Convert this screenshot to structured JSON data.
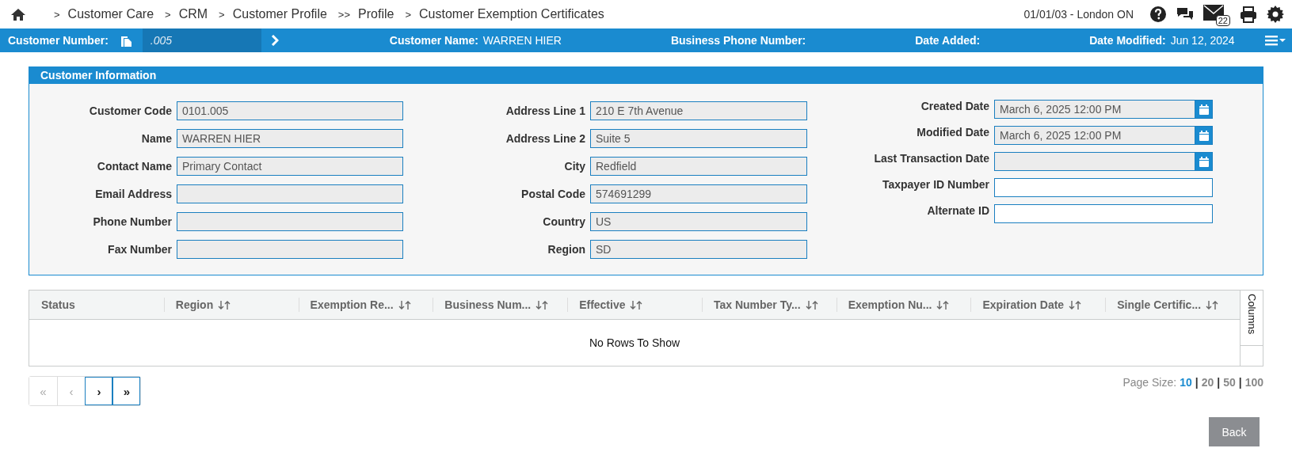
{
  "breadcrumb": {
    "items": [
      {
        "separator": ">",
        "label": "Customer Care"
      },
      {
        "separator": ">",
        "label": "CRM"
      },
      {
        "separator": ">",
        "label": "Customer Profile"
      },
      {
        "separator": ">>",
        "label": "Profile"
      },
      {
        "separator": ">",
        "label": "Customer Exemption Certificates"
      }
    ]
  },
  "top_bar": {
    "location": "01/01/03 - London ON",
    "mail_count": "22"
  },
  "customer_bar": {
    "customer_number_label": "Customer Number:",
    "customer_number": ".005",
    "fields": [
      {
        "label": "Customer Name:",
        "value": "WARREN HIER"
      },
      {
        "label": "Business Phone Number:"
      },
      {
        "label": "Date Added:"
      },
      {
        "label": "Date Modified:",
        "value": "Jun 12, 2024"
      }
    ]
  },
  "panel": {
    "title": "Customer Information",
    "columns": [
      [
        {
          "label": "Customer Code",
          "kind": "readonly",
          "value": "0101.005"
        },
        {
          "label": "Name",
          "kind": "readonly",
          "value": "WARREN HIER"
        },
        {
          "label": "Contact Name",
          "kind": "readonly",
          "value": "Primary Contact"
        },
        {
          "label": "Email Address",
          "kind": "readonly"
        },
        {
          "label": "Phone Number",
          "kind": "readonly"
        },
        {
          "label": "Fax Number",
          "kind": "readonly"
        }
      ],
      [
        {
          "label": "Address Line 1",
          "kind": "readonly",
          "value": "210 E 7th Avenue"
        },
        {
          "label": "Address Line 2",
          "kind": "readonly",
          "value": "Suite 5"
        },
        {
          "label": "City",
          "kind": "readonly",
          "value": "Redfield"
        },
        {
          "label": "Postal Code",
          "kind": "readonly",
          "value": "574691299"
        },
        {
          "label": "Country",
          "kind": "readonly",
          "value": "US"
        },
        {
          "label": "Region",
          "kind": "readonly",
          "value": "SD"
        }
      ],
      [
        {
          "label": "Created Date",
          "kind": "date",
          "value": "March 6, 2025 12:00 PM"
        },
        {
          "label": "Modified Date",
          "kind": "date",
          "value": "March 6, 2025 12:00 PM"
        },
        {
          "label": "Last Transaction Date",
          "kind": "date"
        },
        {
          "label": "Taxpayer ID Number",
          "kind": "text"
        },
        {
          "label": "Alternate ID",
          "kind": "text"
        }
      ]
    ]
  },
  "grid": {
    "columns": [
      {
        "label": "Status",
        "sortable": false
      },
      {
        "label": "Region",
        "sortable": true
      },
      {
        "label": "Exemption Re...",
        "sortable": true
      },
      {
        "label": "Business Num...",
        "sortable": true
      },
      {
        "label": "Effective",
        "sortable": true
      },
      {
        "label": "Tax Number Ty...",
        "sortable": true
      },
      {
        "label": "Exemption Nu...",
        "sortable": true
      },
      {
        "label": "Expiration Date",
        "sortable": true
      },
      {
        "label": "Single Certific...",
        "sortable": true
      }
    ],
    "overlay": "No Rows To Show",
    "side_tab": "Columns"
  },
  "pager": {
    "buttons": [
      {
        "label": "«",
        "disabled": true
      },
      {
        "label": "‹",
        "disabled": true
      },
      {
        "label": "›",
        "disabled": false
      },
      {
        "label": "»",
        "disabled": false
      }
    ]
  },
  "page_size": {
    "label": "Page Size:",
    "options": [
      {
        "label": "10",
        "selected": true
      },
      {
        "separator": "|",
        "label": "20",
        "selected": false
      },
      {
        "separator": "|",
        "label": "50",
        "selected": false
      },
      {
        "separator": "|",
        "label": "100",
        "selected": false
      }
    ]
  },
  "back_button": "Back"
}
